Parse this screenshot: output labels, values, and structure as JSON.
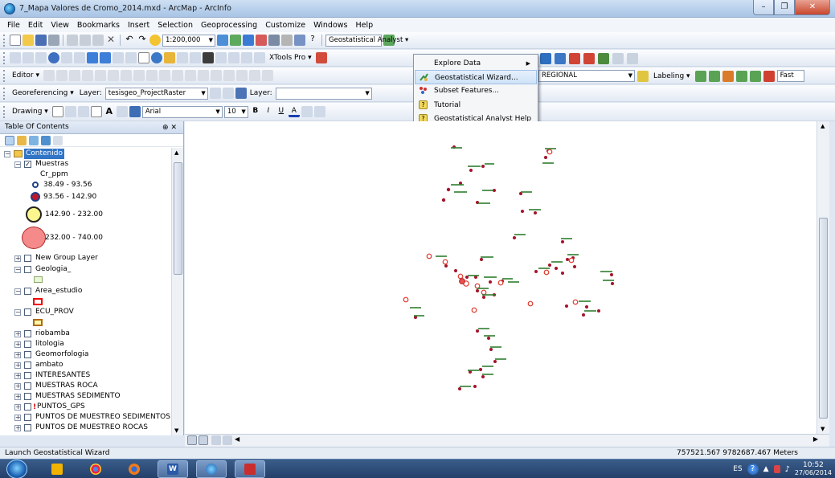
{
  "window": {
    "title": "7_Mapa Valores de Cromo_2014.mxd - ArcMap - ArcInfo"
  },
  "menu": [
    "File",
    "Edit",
    "View",
    "Bookmarks",
    "Insert",
    "Selection",
    "Geoprocessing",
    "Customize",
    "Windows",
    "Help"
  ],
  "toolbar": {
    "scale": "1:200,000",
    "geostat_label": "Geostatistical Analyst ▾",
    "xtools": "XTools Pro ▾",
    "editor": "Editor ▾",
    "regional_combo": "REGIONAL",
    "labeling": "Labeling ▾",
    "fast": "Fast",
    "georef_label": "Georeferencing ▾",
    "georef_layer_label": "Layer:",
    "georef_layer_value": "tesisgeo_ProjectRaster",
    "layer_label": "Layer:",
    "drawing": "Drawing ▾",
    "font": "Arial",
    "font_size": "10"
  },
  "dropdown": {
    "items": [
      {
        "label": "Explore Data",
        "submenu": true,
        "icon": "none"
      },
      {
        "label": "Geostatistical Wizard...",
        "submenu": false,
        "icon": "wizard-icon",
        "highlighted": true
      },
      {
        "label": "Subset Features...",
        "submenu": false,
        "icon": "subset-icon"
      },
      {
        "label": "Tutorial",
        "submenu": false,
        "icon": "help-icon"
      },
      {
        "label": "Geostatistical Analyst Help",
        "submenu": false,
        "icon": "help-icon"
      }
    ]
  },
  "toc": {
    "title": "Table Of Contents",
    "root": "Contenido",
    "muestras": "Muestras",
    "field": "Cr_ppm",
    "classes": [
      "38.49 - 93.56",
      "93.56 - 142.90",
      "142.90 - 232.00",
      "232.00 - 740.00"
    ],
    "layers": [
      "New Group Layer",
      "Geologia_",
      "Area_estudio",
      "ECU_PROV",
      "riobamba",
      "litologia",
      "Geomorfologia",
      "ambato",
      "INTERESANTES",
      "MUESTRAS ROCA",
      "MUESTRAS SEDIMENTO",
      "PUNTOS_GPS",
      "PUNTOS DE MUESTREO SEDIMENTOS",
      "PUNTOS DE MUESTREO ROCAS"
    ]
  },
  "status": {
    "message": "Launch Geostatistical Wizard",
    "coords": "757521.567  9782687.467 Meters"
  },
  "taskbar": {
    "lang": "ES",
    "time": "10:52",
    "date": "27/06/2014"
  }
}
